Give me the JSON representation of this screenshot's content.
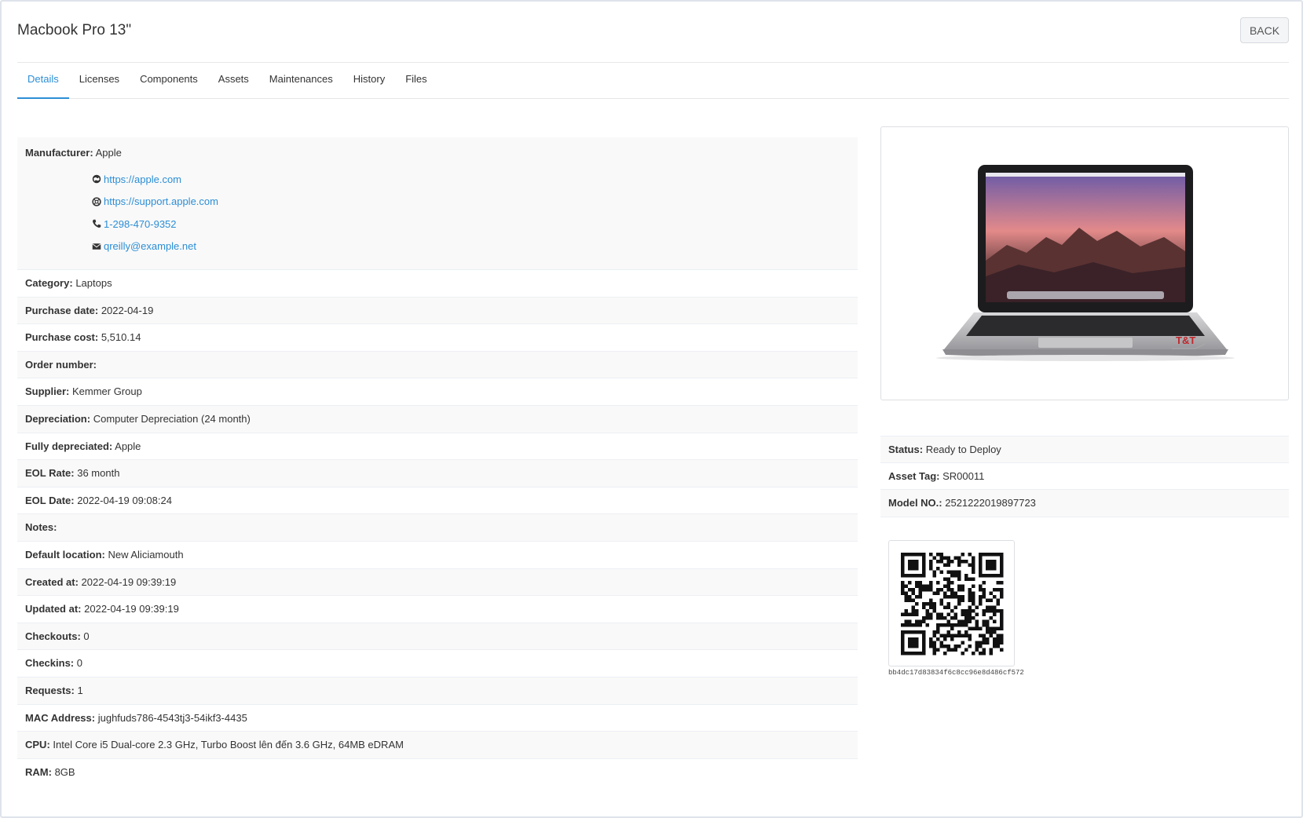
{
  "header": {
    "title": "Macbook Pro 13\"",
    "back_label": "BACK"
  },
  "tabs": [
    {
      "label": "Details",
      "active": true
    },
    {
      "label": "Licenses"
    },
    {
      "label": "Components"
    },
    {
      "label": "Assets"
    },
    {
      "label": "Maintenances"
    },
    {
      "label": "History"
    },
    {
      "label": "Files"
    }
  ],
  "manufacturer": {
    "label": "Manufacturer:",
    "value": "Apple",
    "url": "https://apple.com",
    "support_url": "https://support.apple.com",
    "phone": "1-298-470-9352",
    "email": "qreilly@example.net"
  },
  "details": [
    {
      "label": "Category:",
      "value": "Laptops"
    },
    {
      "label": "Purchase date:",
      "value": "2022-04-19"
    },
    {
      "label": "Purchase cost:",
      "value": "5,510.14"
    },
    {
      "label": "Order number:",
      "value": ""
    },
    {
      "label": "Supplier:",
      "value": "Kemmer Group"
    },
    {
      "label": "Depreciation:",
      "value": "Computer Depreciation (24 month)"
    },
    {
      "label": "Fully depreciated:",
      "value": "Apple"
    },
    {
      "label": "EOL Rate:",
      "value": "36 month"
    },
    {
      "label": "EOL Date:",
      "value": "2022-04-19 09:08:24"
    },
    {
      "label": "Notes:",
      "value": ""
    },
    {
      "label": "Default location:",
      "value": "New Aliciamouth"
    },
    {
      "label": "Created at:",
      "value": "2022-04-19 09:39:19"
    },
    {
      "label": "Updated at:",
      "value": "2022-04-19 09:39:19"
    },
    {
      "label": "Checkouts:",
      "value": "0"
    },
    {
      "label": "Checkins:",
      "value": "0"
    },
    {
      "label": "Requests:",
      "value": "1"
    },
    {
      "label": "MAC Address:",
      "value": "jughfuds786-4543tj3-54ikf3-4435"
    },
    {
      "label": "CPU:",
      "value": "Intel Core i5 Dual-core 2.3 GHz, Turbo Boost lên đến 3.6 GHz, 64MB eDRAM"
    },
    {
      "label": "RAM:",
      "value": "8GB"
    }
  ],
  "side": {
    "status": {
      "label": "Status:",
      "value": "Ready to Deploy"
    },
    "asset_tag": {
      "label": "Asset Tag:",
      "value": "SR00011"
    },
    "model_no": {
      "label": "Model NO.:",
      "value": "2521222019897723"
    },
    "qr_code_text": "bb4dc17d83834f6c8cc96e8d486cf572"
  },
  "colors": {
    "link": "#2c8ed6",
    "stripe": "#f9f9f9",
    "border": "#eceff3"
  }
}
